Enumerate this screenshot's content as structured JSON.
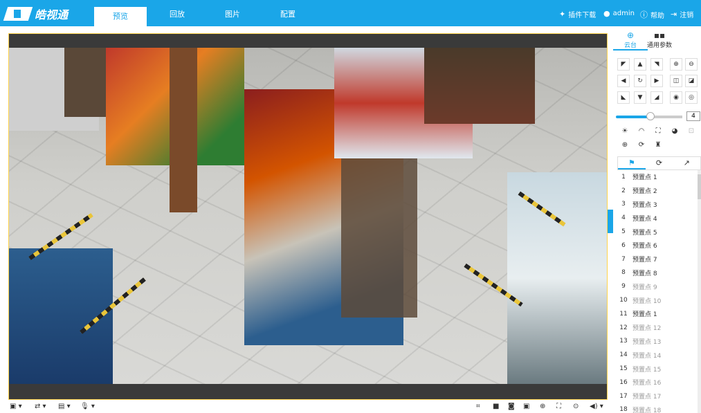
{
  "brand": {
    "name": "皓视通"
  },
  "nav": {
    "tabs": [
      {
        "label": "预览",
        "active": true
      },
      {
        "label": "回放",
        "active": false
      },
      {
        "label": "图片",
        "active": false
      },
      {
        "label": "配置",
        "active": false
      }
    ],
    "right": [
      {
        "icon": "plugin-icon",
        "label": "插件下载"
      },
      {
        "icon": "user-icon",
        "label": "admin"
      },
      {
        "icon": "help-icon",
        "label": "帮助"
      },
      {
        "icon": "logout-icon",
        "label": "注销"
      }
    ]
  },
  "panel": {
    "tabs": [
      {
        "label": "云台",
        "icon": "ptz-icon",
        "active": true
      },
      {
        "label": "通用参数",
        "icon": "grid-icon",
        "active": false
      }
    ],
    "speed": "4",
    "speed_fraction": 0.5,
    "preset_tabs": [
      {
        "icon": "preset-flag-icon",
        "glyph": "⚑",
        "active": true
      },
      {
        "icon": "patrol-icon",
        "glyph": "⟳",
        "active": false
      },
      {
        "icon": "pattern-icon",
        "glyph": "↗",
        "active": false
      }
    ],
    "presets": [
      {
        "num": "1",
        "name": "预置点 1",
        "active": true
      },
      {
        "num": "2",
        "name": "预置点 2",
        "active": true
      },
      {
        "num": "3",
        "name": "预置点 3",
        "active": true
      },
      {
        "num": "4",
        "name": "预置点 4",
        "active": true
      },
      {
        "num": "5",
        "name": "预置点 5",
        "active": true
      },
      {
        "num": "6",
        "name": "预置点 6",
        "active": true
      },
      {
        "num": "7",
        "name": "预置点 7",
        "active": true
      },
      {
        "num": "8",
        "name": "预置点 8",
        "active": true
      },
      {
        "num": "9",
        "name": "预置点 9",
        "active": false
      },
      {
        "num": "10",
        "name": "预置点 10",
        "active": false
      },
      {
        "num": "11",
        "name": "预置点 1",
        "active": true
      },
      {
        "num": "12",
        "name": "预置点 12",
        "active": false
      },
      {
        "num": "13",
        "name": "预置点 13",
        "active": false
      },
      {
        "num": "14",
        "name": "预置点 14",
        "active": false
      },
      {
        "num": "15",
        "name": "预置点 15",
        "active": false
      },
      {
        "num": "16",
        "name": "预置点 16",
        "active": false
      },
      {
        "num": "17",
        "name": "预置点 17",
        "active": false
      },
      {
        "num": "18",
        "name": "预置点 18",
        "active": false
      }
    ]
  },
  "colors": {
    "brand": "#1aa6e8",
    "frame": "#ffd44a"
  }
}
